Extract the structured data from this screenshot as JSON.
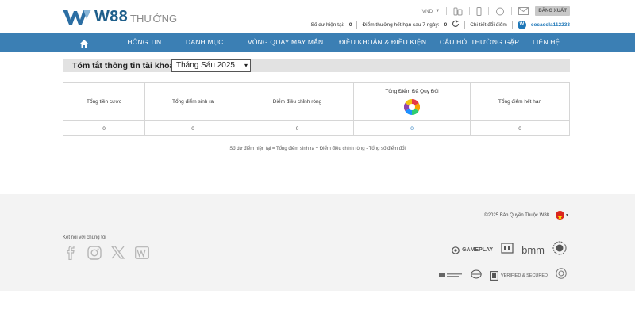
{
  "brand": {
    "name": "W88",
    "sub": "THƯỞNG",
    "logo_letter": "W"
  },
  "header": {
    "currency": "VND",
    "logout_label": "ĐĂNG XUẤT",
    "balance_label": "Số dư hiện tại:",
    "balance_value": "0",
    "expiring_label": "Điểm thưởng hết hạn sau 7 ngày:",
    "expiring_value": "0",
    "redeem_details_link": "Chi tiết đổi điểm",
    "username": "cocacola112233",
    "icons": [
      "caret-down-icon",
      "device-icon",
      "mobile-icon",
      "chat-icon",
      "mail-icon",
      "refresh-icon",
      "user-icon"
    ]
  },
  "nav": {
    "items": [
      "THÔNG TIN",
      "DANH MỤC",
      "VÒNG QUAY MAY MẮN",
      "ĐIỀU KHOẢN & ĐIỀU KIỆN",
      "CÂU HỎI THƯỜNG GẶP",
      "LIÊN HỆ"
    ]
  },
  "summary": {
    "title": "Tóm tắt thông tin tài khoản",
    "month_selected": "Tháng Sáu 2025",
    "columns": [
      "Tổng tiền cược",
      "Tổng điểm sinh ra",
      "Điểm điều chỉnh ròng",
      "Tổng Điểm Đã Quy Đổi",
      "Tổng điểm hết hạn"
    ],
    "values": [
      "0",
      "0",
      "0",
      "0",
      "0"
    ],
    "formula": "Số dư điểm hiện tại = Tổng điểm sinh ra + Điểm điều chỉnh ròng - Tổng số điểm đổi"
  },
  "footer": {
    "copyright": "©2025 Bản Quyền Thuộc W88",
    "connect_label": "Kết nối với chúng tôi",
    "social_icons": [
      "facebook-icon",
      "instagram-icon",
      "x-icon",
      "w88-icon"
    ],
    "partners_row1": [
      "GAMEPLAY",
      "bmm"
    ],
    "partners_row2": [
      "VERIFIED & SECURED"
    ]
  },
  "colors": {
    "nav_bg": "#3b7fb4",
    "brand_blue": "#1f5f8b",
    "link_blue": "#1e77b8",
    "footer_bg": "#f3f3f3"
  }
}
